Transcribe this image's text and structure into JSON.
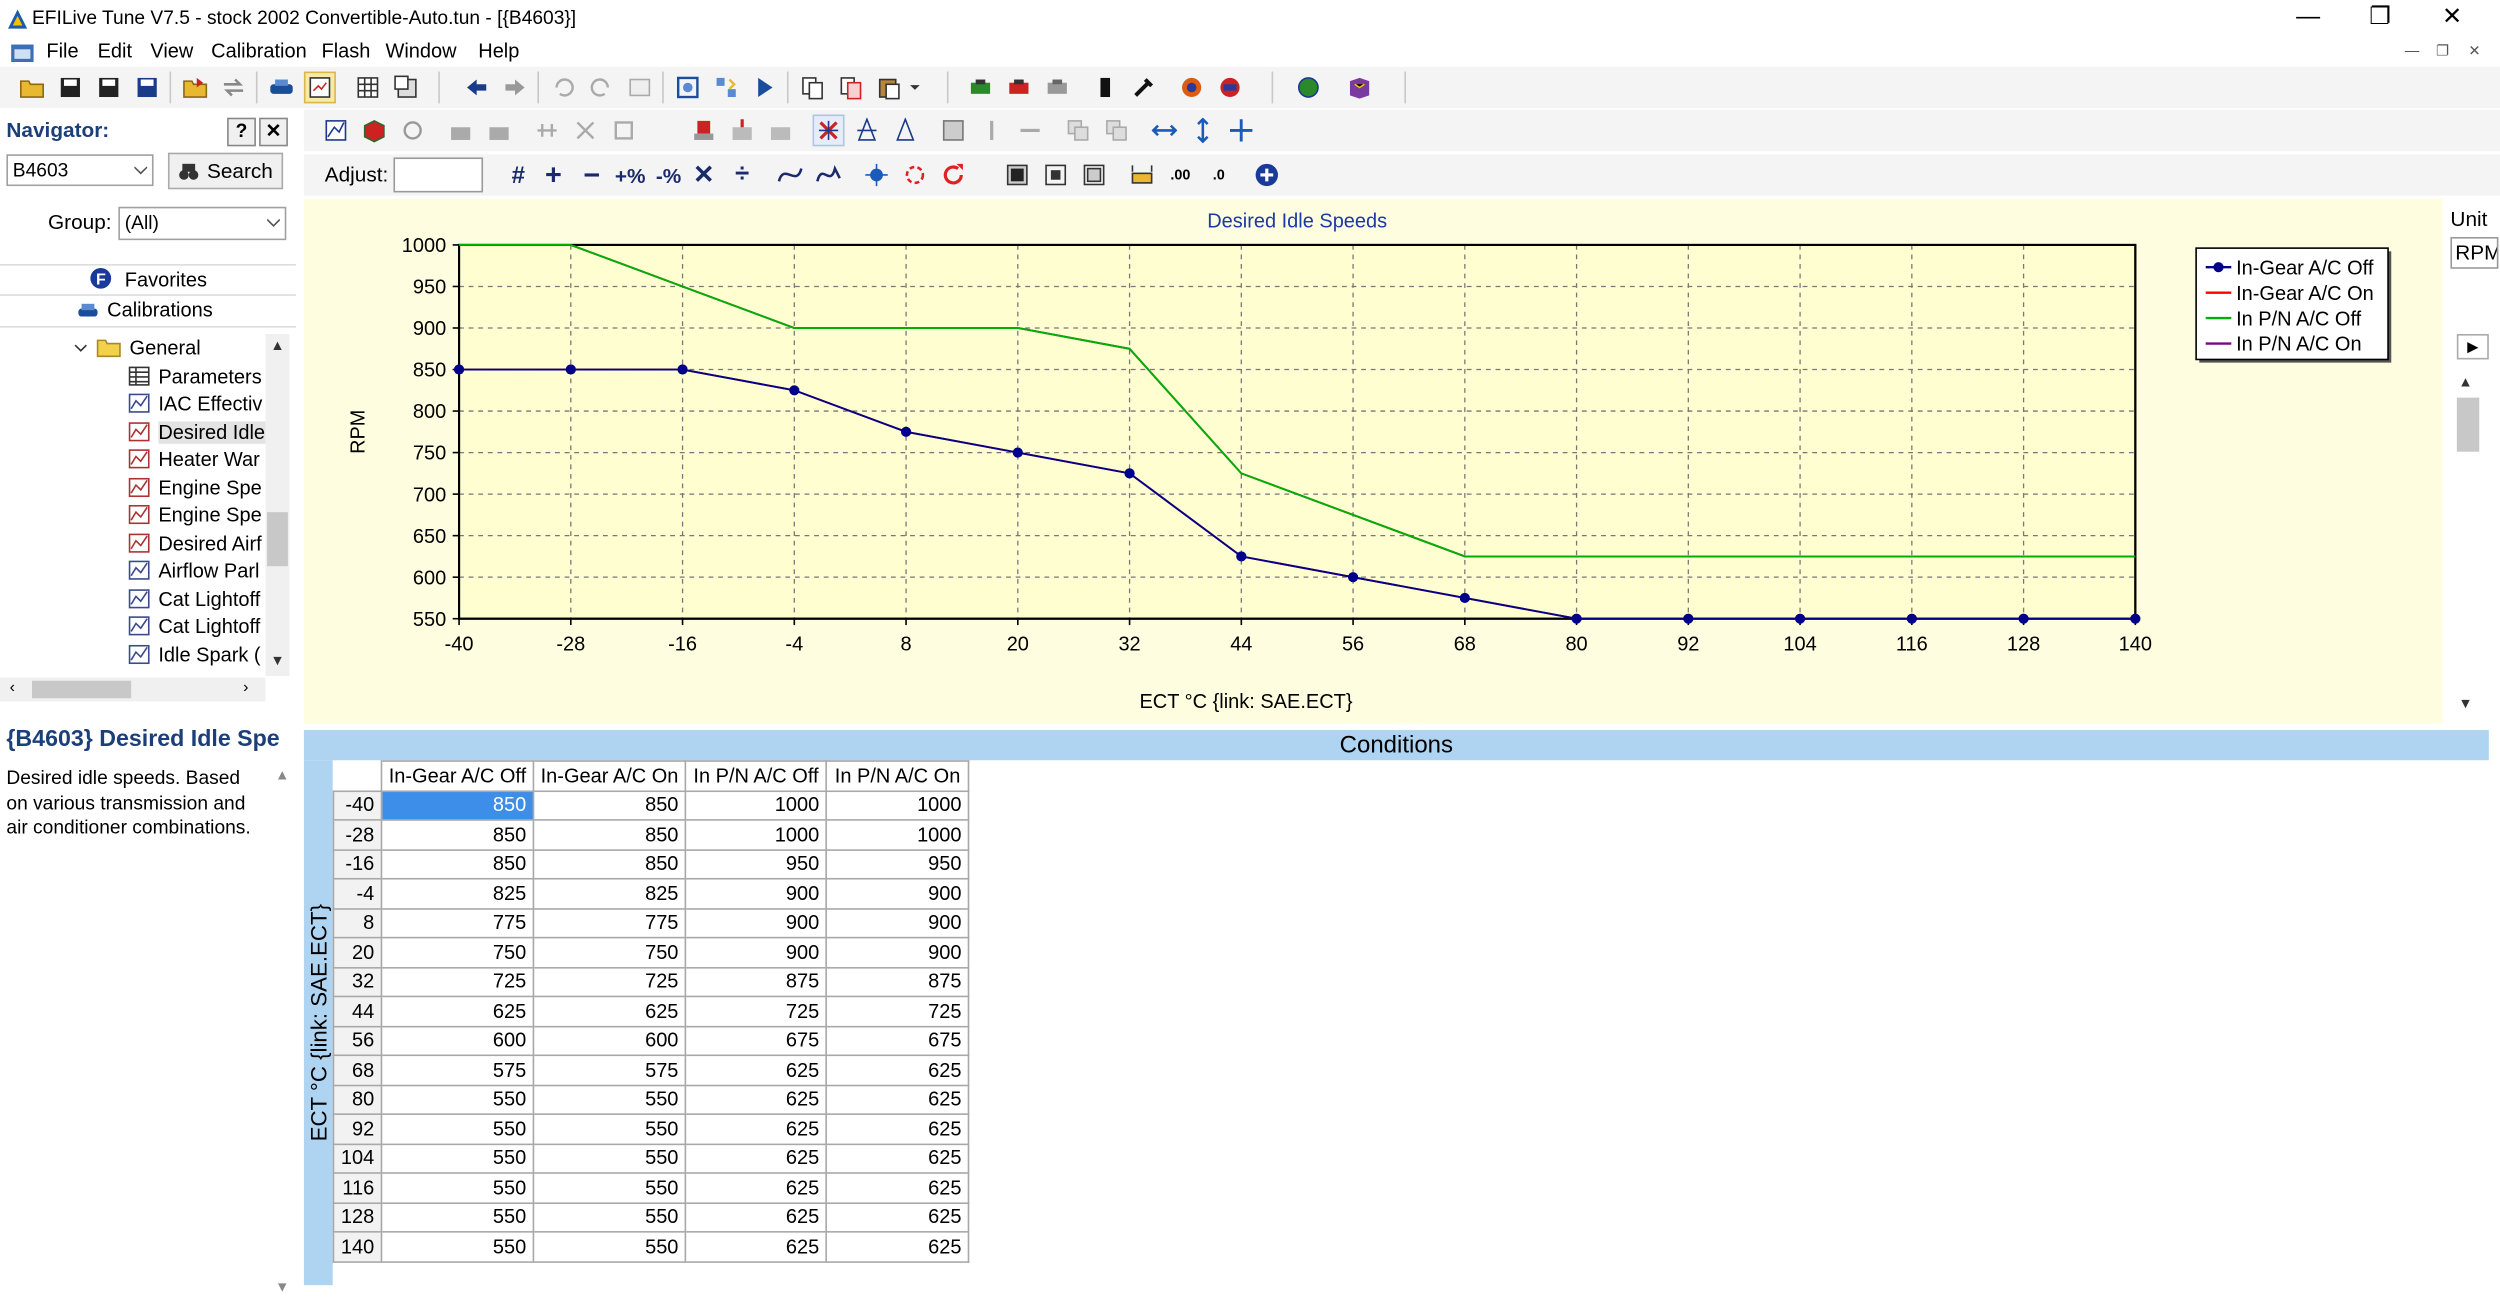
{
  "window": {
    "title": "EFILive Tune V7.5 - stock 2002 Convertible-Auto.tun - [{B4603}]"
  },
  "menu": [
    "File",
    "Edit",
    "View",
    "Calibration",
    "Flash",
    "Window",
    "Help"
  ],
  "adjust": {
    "label": "Adjust:",
    "value": ""
  },
  "navigator": {
    "title": "Navigator:",
    "help": "?",
    "close": "✕",
    "search_value": "B4603",
    "search_label": "Search",
    "group_label": "Group:",
    "group_value": "(All)",
    "favorites": "Favorites",
    "calibrations": "Calibrations",
    "tree": [
      "General",
      "Parameters",
      "IAC Effectiv",
      "Desired Idle",
      "Heater War",
      "Engine Spe",
      "Engine Spe",
      "Desired Airf",
      "Airflow Parl",
      "Cat Lightoff",
      "Cat Lightoff",
      "Idle Spark ("
    ]
  },
  "description": {
    "title": "{B4603} Desired Idle Spe",
    "text": "Desired idle speeds. Based on various transmission and air conditioner combinations."
  },
  "right_pane": {
    "unit_label": "Unit",
    "unit_value": "RPM"
  },
  "conditions_label": "Conditions",
  "table": {
    "row_axis_label": "ECT °C {link: SAE.ECT}",
    "columns": [
      "In-Gear A/C Off",
      "In-Gear A/C On",
      "In P/N A/C Off",
      "In P/N A/C On"
    ],
    "rows": [
      {
        "h": "-40",
        "v": [
          "850",
          "850",
          "1000",
          "1000"
        ]
      },
      {
        "h": "-28",
        "v": [
          "850",
          "850",
          "1000",
          "1000"
        ]
      },
      {
        "h": "-16",
        "v": [
          "850",
          "850",
          "950",
          "950"
        ]
      },
      {
        "h": "-4",
        "v": [
          "825",
          "825",
          "900",
          "900"
        ]
      },
      {
        "h": "8",
        "v": [
          "775",
          "775",
          "900",
          "900"
        ]
      },
      {
        "h": "20",
        "v": [
          "750",
          "750",
          "900",
          "900"
        ]
      },
      {
        "h": "32",
        "v": [
          "725",
          "725",
          "875",
          "875"
        ]
      },
      {
        "h": "44",
        "v": [
          "625",
          "625",
          "725",
          "725"
        ]
      },
      {
        "h": "56",
        "v": [
          "600",
          "600",
          "675",
          "675"
        ]
      },
      {
        "h": "68",
        "v": [
          "575",
          "575",
          "625",
          "625"
        ]
      },
      {
        "h": "80",
        "v": [
          "550",
          "550",
          "625",
          "625"
        ]
      },
      {
        "h": "92",
        "v": [
          "550",
          "550",
          "625",
          "625"
        ]
      },
      {
        "h": "104",
        "v": [
          "550",
          "550",
          "625",
          "625"
        ]
      },
      {
        "h": "116",
        "v": [
          "550",
          "550",
          "625",
          "625"
        ]
      },
      {
        "h": "128",
        "v": [
          "550",
          "550",
          "625",
          "625"
        ]
      },
      {
        "h": "140",
        "v": [
          "550",
          "550",
          "625",
          "625"
        ]
      }
    ]
  },
  "chart_data": {
    "type": "line",
    "title": "Desired Idle Speeds",
    "xlabel": "ECT °C {link: SAE.ECT}",
    "ylabel": "RPM",
    "x": [
      -40,
      -28,
      -16,
      -4,
      8,
      20,
      32,
      44,
      56,
      68,
      80,
      92,
      104,
      116,
      128,
      140
    ],
    "xlim": [
      -40,
      140
    ],
    "ylim": [
      550,
      1000
    ],
    "yticks": [
      550,
      600,
      650,
      700,
      750,
      800,
      850,
      900,
      950,
      1000
    ],
    "grid": true,
    "legend": "top-right",
    "series": [
      {
        "name": "In-Gear A/C Off",
        "color": "#00008b",
        "marker": true,
        "values": [
          850,
          850,
          850,
          825,
          775,
          750,
          725,
          625,
          600,
          575,
          550,
          550,
          550,
          550,
          550,
          550
        ]
      },
      {
        "name": "In-Gear A/C On",
        "color": "#ff0000",
        "marker": false,
        "values": [
          850,
          850,
          850,
          825,
          775,
          750,
          725,
          625,
          600,
          575,
          550,
          550,
          550,
          550,
          550,
          550
        ]
      },
      {
        "name": "In P/N A/C Off",
        "color": "#00b000",
        "marker": false,
        "values": [
          1000,
          1000,
          950,
          900,
          900,
          900,
          875,
          725,
          675,
          625,
          625,
          625,
          625,
          625,
          625,
          625
        ]
      },
      {
        "name": "In P/N A/C On",
        "color": "#800080",
        "marker": false,
        "values": [
          1000,
          1000,
          950,
          900,
          900,
          900,
          875,
          725,
          675,
          625,
          625,
          625,
          625,
          625,
          625,
          625
        ]
      }
    ]
  }
}
